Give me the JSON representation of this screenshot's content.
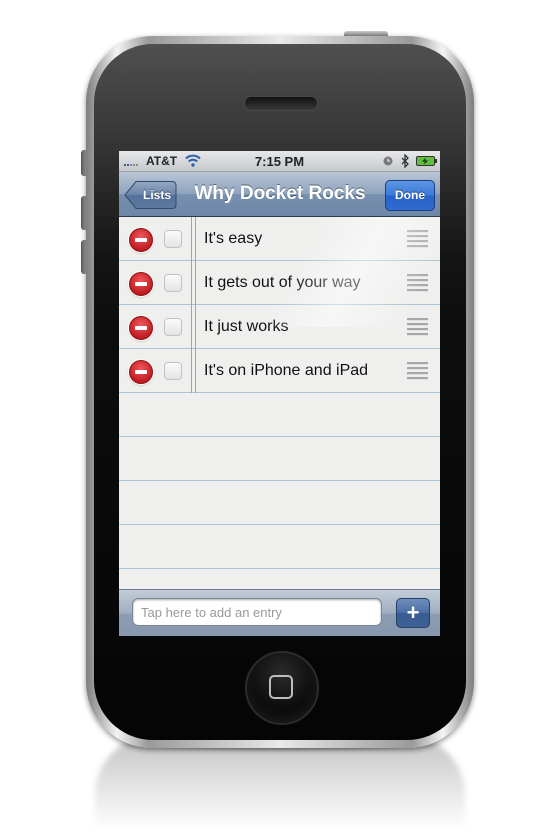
{
  "status_bar": {
    "carrier": "AT&T",
    "time": "7:15 PM",
    "icons": [
      "signal-icon",
      "wifi-icon",
      "alarm-icon",
      "bluetooth-icon",
      "battery-charging-icon"
    ]
  },
  "nav_bar": {
    "back_label": "Lists",
    "title": "Why Docket Rocks",
    "done_label": "Done"
  },
  "list": {
    "items": [
      {
        "text": "It's easy",
        "checked": false
      },
      {
        "text": "It gets out of your way",
        "checked": false
      },
      {
        "text": "It just works",
        "checked": false
      },
      {
        "text": "It's on iPhone and iPad",
        "checked": false
      }
    ]
  },
  "bottom_bar": {
    "entry_placeholder": "Tap here to add an entry",
    "entry_value": "",
    "add_label": "+"
  },
  "colors": {
    "nav_bar": "#7790ae",
    "done_button": "#3b78d8",
    "delete_button": "#c01d22",
    "margin_line": "#d98b8b",
    "ruled_line": "#a8c4d8"
  }
}
